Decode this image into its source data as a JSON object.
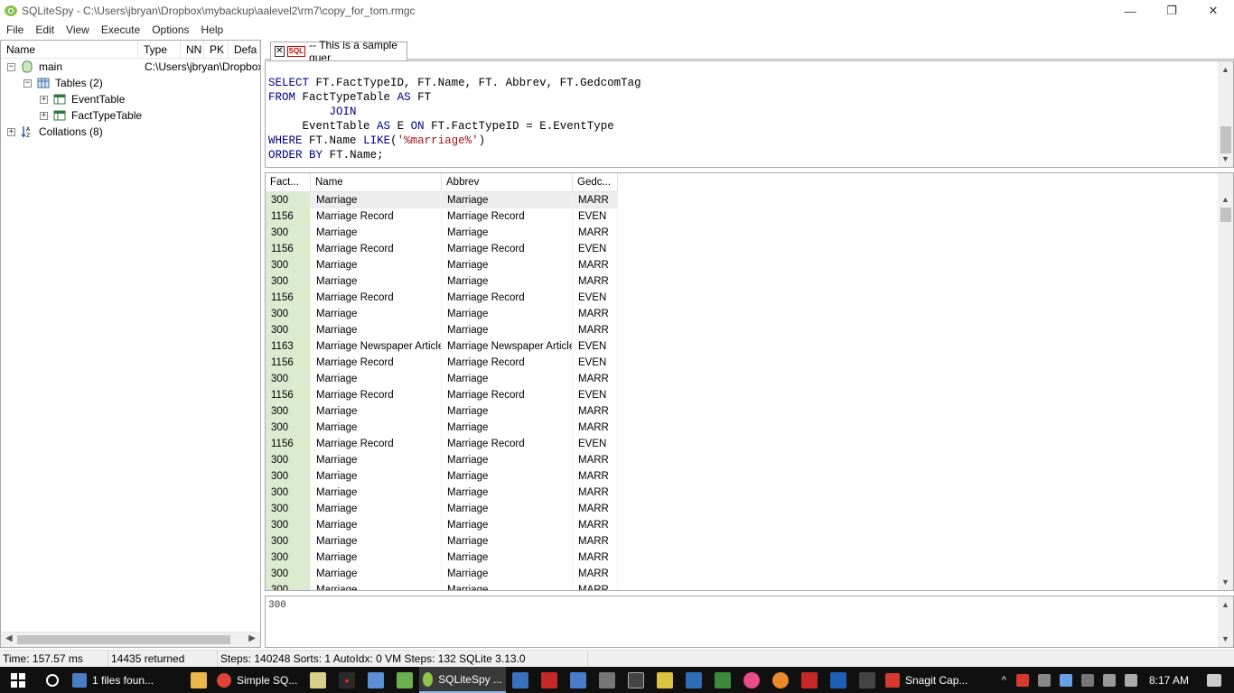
{
  "window": {
    "title": "SQLiteSpy - C:\\Users\\jbryan\\Dropbox\\mybackup\\aalevel2\\rm7\\copy_for_tom.rmgc",
    "minimize": "—",
    "restore": "❐",
    "close": "✕"
  },
  "menu": [
    "File",
    "Edit",
    "View",
    "Execute",
    "Options",
    "Help"
  ],
  "schema_tree": {
    "columns": [
      "Name",
      "Type",
      "NN",
      "PK",
      "Defa"
    ],
    "nodes": {
      "main": {
        "label": "main",
        "path": "C:\\Users\\jbryan\\Dropbox\\"
      },
      "tables": {
        "label": "Tables (2)"
      },
      "event_table": {
        "label": "EventTable"
      },
      "fact_type_table": {
        "label": "FactTypeTable"
      },
      "collations": {
        "label": "Collations (8)"
      }
    }
  },
  "editor": {
    "tab_label": "-- This is a sample quer",
    "sql_badge": "SQL",
    "sql_lines": [
      "SELECT FT.FactTypeID, FT.Name, FT. Abbrev, FT.GedcomTag",
      "FROM FactTypeTable AS FT",
      "         JOIN",
      "     EventTable AS E ON FT.FactTypeID = E.EventType",
      "WHERE FT.Name LIKE('%marriage%')",
      "ORDER BY FT.Name;"
    ]
  },
  "results": {
    "headers": [
      "Fact...",
      "Name",
      "Abbrev",
      "Gedc..."
    ],
    "rows": [
      [
        "300",
        "Marriage",
        "Marriage",
        "MARR"
      ],
      [
        "1156",
        "Marriage Record",
        "Marriage Record",
        "EVEN"
      ],
      [
        "300",
        "Marriage",
        "Marriage",
        "MARR"
      ],
      [
        "1156",
        "Marriage Record",
        "Marriage Record",
        "EVEN"
      ],
      [
        "300",
        "Marriage",
        "Marriage",
        "MARR"
      ],
      [
        "300",
        "Marriage",
        "Marriage",
        "MARR"
      ],
      [
        "1156",
        "Marriage Record",
        "Marriage Record",
        "EVEN"
      ],
      [
        "300",
        "Marriage",
        "Marriage",
        "MARR"
      ],
      [
        "300",
        "Marriage",
        "Marriage",
        "MARR"
      ],
      [
        "1163",
        "Marriage Newspaper Article",
        "Marriage Newspaper Article",
        "EVEN"
      ],
      [
        "1156",
        "Marriage Record",
        "Marriage Record",
        "EVEN"
      ],
      [
        "300",
        "Marriage",
        "Marriage",
        "MARR"
      ],
      [
        "1156",
        "Marriage Record",
        "Marriage Record",
        "EVEN"
      ],
      [
        "300",
        "Marriage",
        "Marriage",
        "MARR"
      ],
      [
        "300",
        "Marriage",
        "Marriage",
        "MARR"
      ],
      [
        "1156",
        "Marriage Record",
        "Marriage Record",
        "EVEN"
      ],
      [
        "300",
        "Marriage",
        "Marriage",
        "MARR"
      ],
      [
        "300",
        "Marriage",
        "Marriage",
        "MARR"
      ],
      [
        "300",
        "Marriage",
        "Marriage",
        "MARR"
      ],
      [
        "300",
        "Marriage",
        "Marriage",
        "MARR"
      ],
      [
        "300",
        "Marriage",
        "Marriage",
        "MARR"
      ],
      [
        "300",
        "Marriage",
        "Marriage",
        "MARR"
      ],
      [
        "300",
        "Marriage",
        "Marriage",
        "MARR"
      ],
      [
        "300",
        "Marriage",
        "Marriage",
        "MARR"
      ],
      [
        "300",
        "Marriage",
        "Marriage",
        "MARR"
      ]
    ],
    "selected_row": 0
  },
  "detail": {
    "value": "300"
  },
  "status": {
    "time": "Time: 157.57 ms",
    "returned": "14435 returned",
    "stats": "Steps: 140248  Sorts: 1  AutoIdx: 0  VM Steps: 132  SQLite 3.13.0"
  },
  "taskbar": {
    "items": [
      {
        "label": "1 files foun...",
        "icon": "search-results-icon"
      },
      {
        "label": "Simple SQ...",
        "icon": "chrome-icon"
      },
      {
        "label": "SQLiteSpy ...",
        "icon": "sqlitespy-icon",
        "active": true
      },
      {
        "label": "Snagit Cap...",
        "icon": "snagit-icon"
      }
    ],
    "clock": "8:17 AM"
  },
  "colors": {
    "keyword": "#00008b",
    "string": "#a31515",
    "first_column_bg": "#dcebd0",
    "taskbar_bg": "#101010"
  }
}
